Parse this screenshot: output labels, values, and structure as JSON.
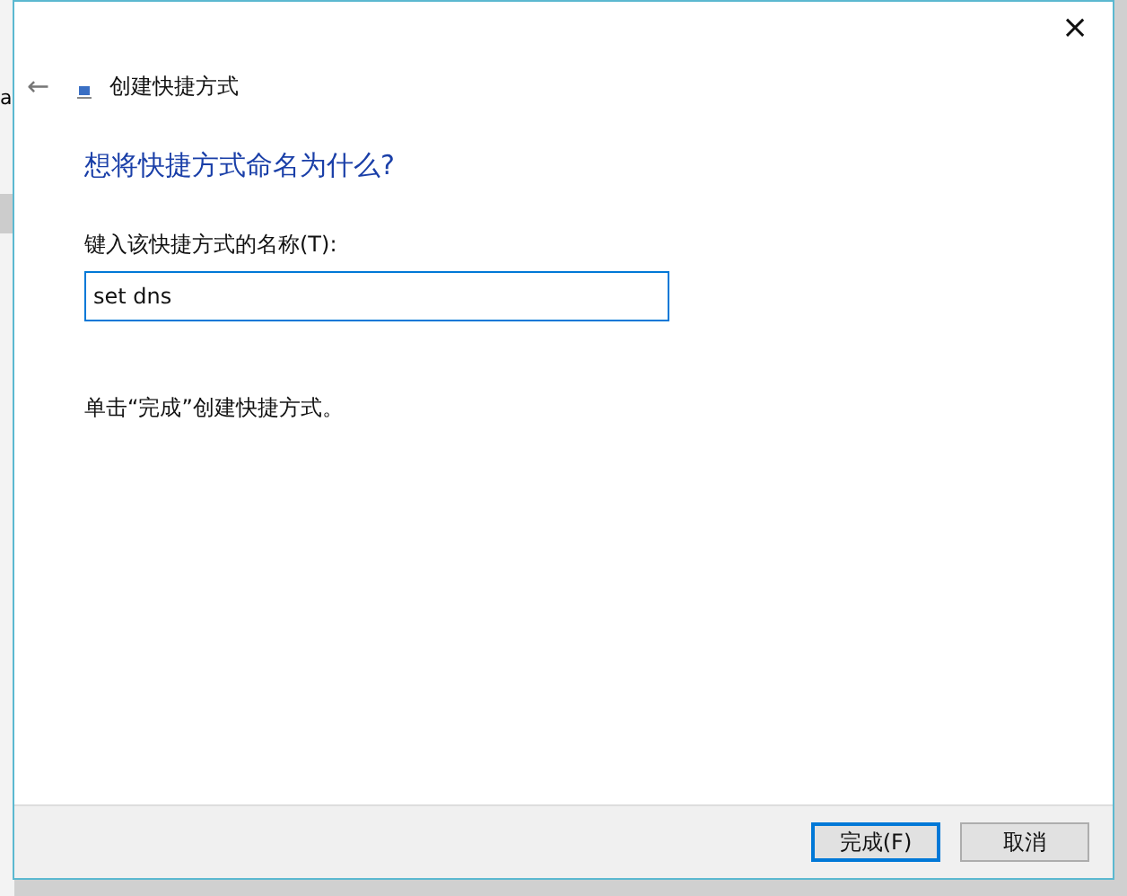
{
  "background_window": {
    "text": "a"
  },
  "window": {
    "title": "创建快捷方式",
    "close": "×",
    "back": "←"
  },
  "heading": "想将快捷方式命名为什么?",
  "name_field": {
    "label": "键入该快捷方式的名称(T):",
    "value": "set dns"
  },
  "hint": "单击“完成”创建快捷方式。",
  "buttons": [
    {
      "label": "完成(F)",
      "selected": true
    },
    {
      "label": "取消",
      "selected": false
    }
  ]
}
